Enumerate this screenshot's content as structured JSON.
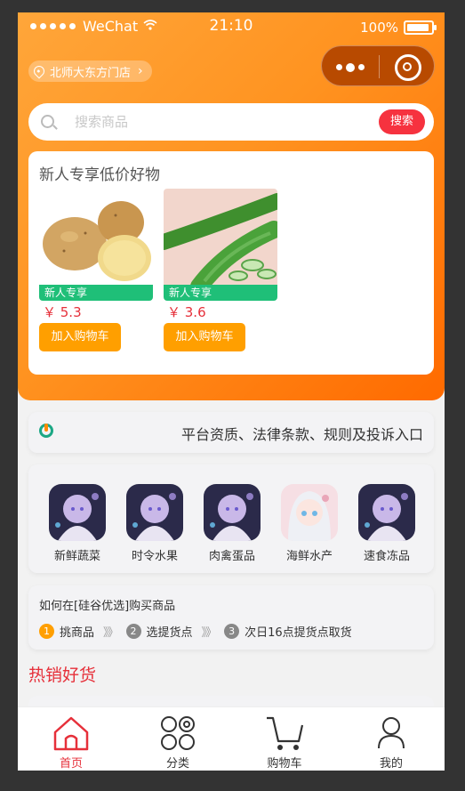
{
  "status": {
    "carrier": "WeChat",
    "time": "21:10",
    "battery": "100%"
  },
  "header": {
    "location": "北师大东方门店"
  },
  "search": {
    "placeholder": "搜索商品",
    "button": "搜索"
  },
  "new_user": {
    "title": "新人专享低价好物",
    "products": [
      {
        "name": "土豆",
        "tag": "新人专享",
        "price": "￥ 5.3",
        "cart": "加入购物车"
      },
      {
        "name": "黄瓜",
        "tag": "新人专享",
        "price": "￥ 3.6",
        "cart": "加入购物车"
      }
    ]
  },
  "info_bar": {
    "text": "平台资质、法律条款、规则及投诉入口"
  },
  "categories": [
    "新鲜蔬菜",
    "时令水果",
    "肉禽蛋品",
    "海鲜水产",
    "速食冻品"
  ],
  "guide": {
    "question": "如何在[硅谷优选]购买商品",
    "steps": [
      {
        "num": "1",
        "label": "挑商品",
        "color": "#ff9f00"
      },
      {
        "num": "2",
        "label": "选提货点",
        "color": "#888888"
      },
      {
        "num": "3",
        "label": "次日16点提货点取货",
        "color": "#888888"
      }
    ],
    "arrow": "》》"
  },
  "hot": {
    "title": "热销好货"
  },
  "tabbar": {
    "items": [
      {
        "label": "首页",
        "icon": "home-icon"
      },
      {
        "label": "分类",
        "icon": "category-icon"
      },
      {
        "label": "购物车",
        "icon": "cart-icon"
      },
      {
        "label": "我的",
        "icon": "user-icon"
      }
    ]
  },
  "colors": {
    "accent": "#ff9320",
    "red": "#e6303a",
    "green": "#1fbf78"
  }
}
